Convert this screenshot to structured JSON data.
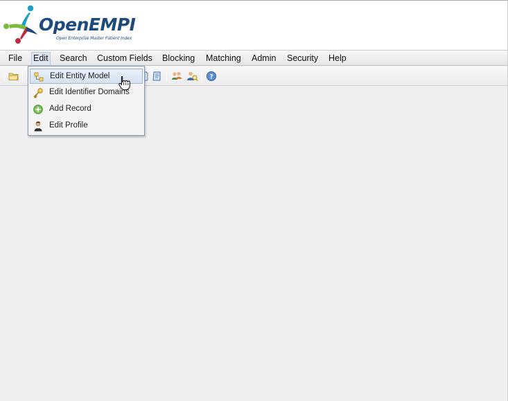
{
  "logo": {
    "brand": "OpenEMPI",
    "tagline": "Open Enterprise Master Patient Index"
  },
  "menubar": {
    "items": [
      {
        "label": "File"
      },
      {
        "label": "Edit"
      },
      {
        "label": "Search"
      },
      {
        "label": "Custom Fields"
      },
      {
        "label": "Blocking"
      },
      {
        "label": "Matching"
      },
      {
        "label": "Admin"
      },
      {
        "label": "Security"
      },
      {
        "label": "Help"
      }
    ],
    "active": "Edit"
  },
  "toolbar": {
    "buttons": [
      {
        "icon": "open-folder-icon"
      },
      {
        "icon": "document-icon"
      },
      {
        "icon": "document-blue-icon"
      },
      {
        "icon": "users-icon"
      },
      {
        "icon": "user-search-icon"
      },
      {
        "icon": "help-icon"
      }
    ]
  },
  "edit_menu": {
    "items": [
      {
        "label": "Edit Entity Model",
        "icon": "entity-model-icon",
        "highlighted": true
      },
      {
        "label": "Edit Identifier Domains",
        "icon": "key-icon"
      },
      {
        "label": "Add Record",
        "icon": "add-circle-icon"
      },
      {
        "label": "Edit Profile",
        "icon": "user-profile-icon"
      }
    ]
  },
  "colors": {
    "brand_blue": "#1f4a7c",
    "brand_green": "#7dbb3c",
    "brand_red": "#c0283c",
    "brand_teal": "#1ea0c3",
    "menu_highlight": "#d5e2f2"
  }
}
